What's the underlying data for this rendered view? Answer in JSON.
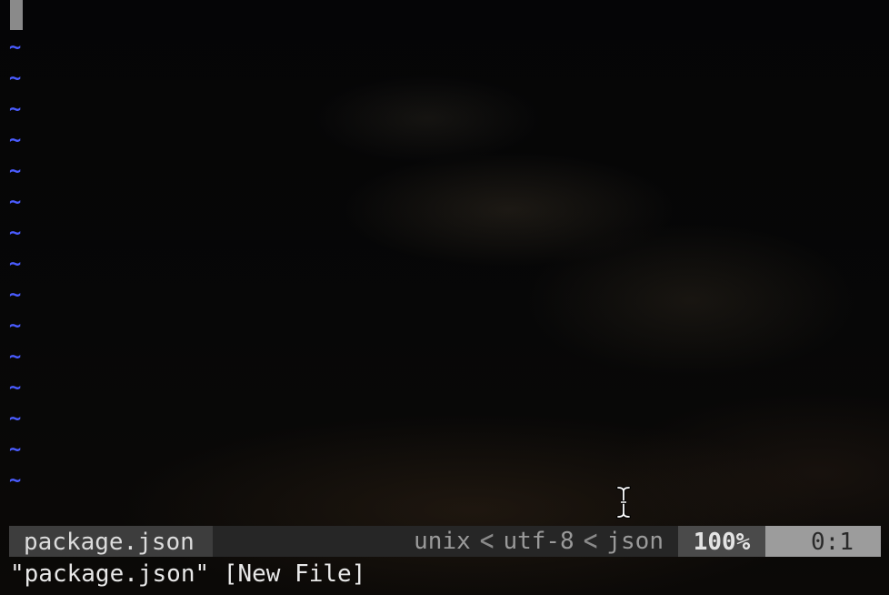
{
  "editor": {
    "empty_line_marker": "~",
    "empty_line_count": 15,
    "cursor_shape": "block"
  },
  "statusline": {
    "filename": "package.json",
    "fileformat": "unix",
    "encoding": "utf-8",
    "filetype": "json",
    "separator": "<",
    "percent": "100%",
    "position": "0:1"
  },
  "cmdline": {
    "message": "\"package.json\" [New File]"
  },
  "mouse_cursor": {
    "icon": "ibeam-cursor-icon"
  },
  "colors": {
    "tilde": "#4a5cff",
    "status_file_bg": "#3d3d3d",
    "status_mid_bg": "#262626",
    "status_pct_bg": "#4a4a4a",
    "status_pos_bg": "#9c9c9c"
  }
}
